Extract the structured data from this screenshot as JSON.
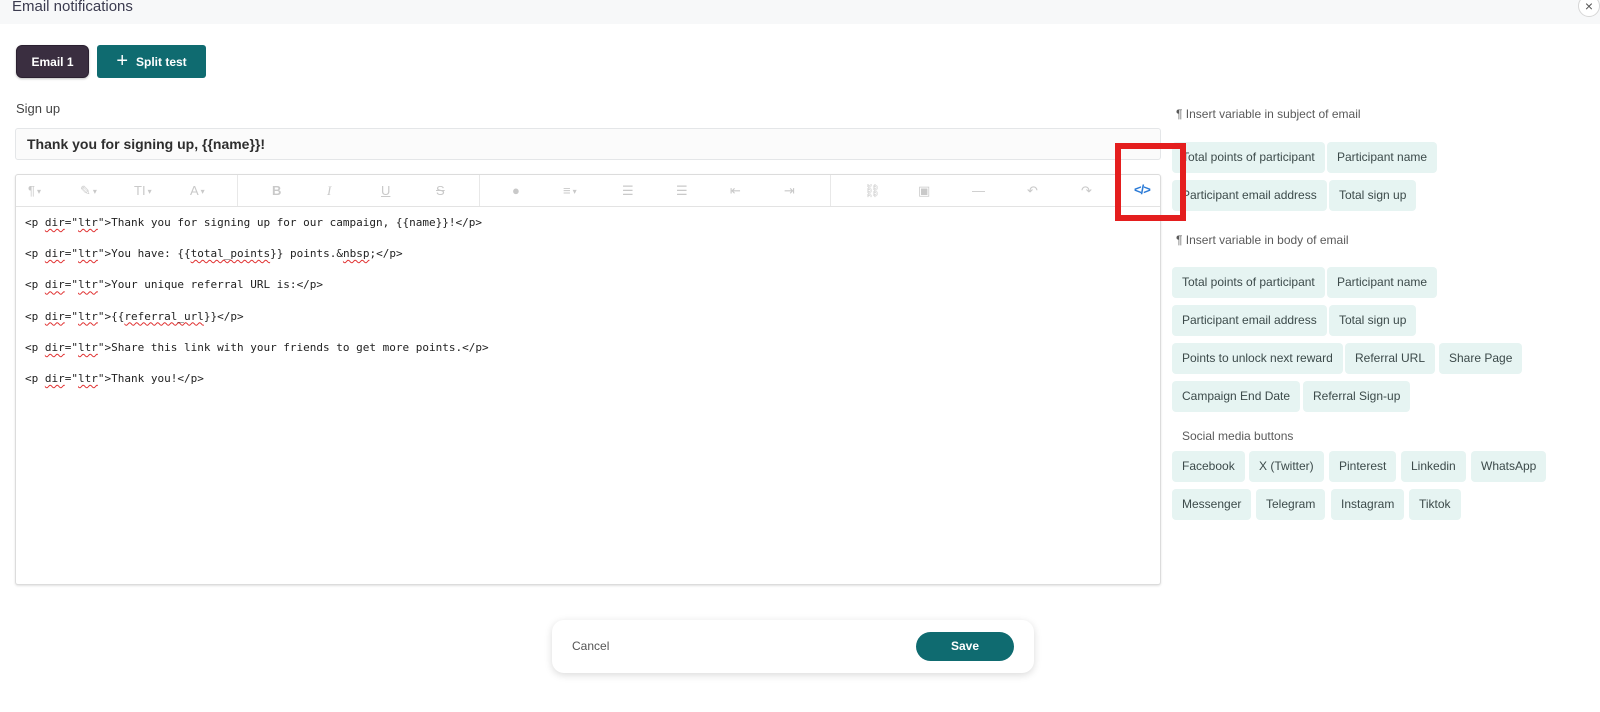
{
  "modal": {
    "title": "Email notifications",
    "close_glyph": "×"
  },
  "tabs": {
    "email_tab": "Email 1",
    "split_test": "Split test"
  },
  "section_label": "Sign up",
  "subject": {
    "value": "Thank you for signing up, {{name}}!"
  },
  "toolbar": {
    "paragraph": "¶",
    "text_size": "TI",
    "font_color": "A",
    "bold": "B",
    "italic": "I",
    "underline": "U",
    "strike": "S",
    "code_view": "</>"
  },
  "code_lines": {
    "l1": "Thank you for signing up for our campaign, {{name}}!",
    "l2_a": "You have: {{",
    "l2_var": "total_points",
    "l2_b": "}} points.&",
    "l2_nbsp": "nbsp",
    "l2_c": ";",
    "l3": "Your unique referral URL is:",
    "l4_a": "{{",
    "l4_var": "referral_url",
    "l4_b": "}}",
    "l5": "Share this link with your friends to get more points.",
    "l6": "Thank you!"
  },
  "subject_panel": {
    "heading": "¶ Insert variable in subject of email",
    "chips": [
      "Total points of participant",
      "Participant name",
      "Participant email address",
      "Total sign up"
    ]
  },
  "body_panel": {
    "heading": "¶ Insert variable in body of email",
    "chips": [
      "Total points of participant",
      "Participant name",
      "Participant email address",
      "Total sign up",
      "Points to unlock next reward",
      "Referral URL",
      "Share Page",
      "Campaign End Date",
      "Referral Sign-up"
    ]
  },
  "social": {
    "heading": "Social media buttons",
    "chips": [
      "Facebook",
      "X (Twitter)",
      "Pinterest",
      "Linkedin",
      "WhatsApp",
      "Messenger",
      "Telegram",
      "Instagram",
      "Tiktok"
    ]
  },
  "footer": {
    "cancel": "Cancel",
    "save": "Save"
  },
  "colors": {
    "primary": "#0f6b70",
    "tab_active": "#3a2e40",
    "chip_bg": "#e6f4f2",
    "highlight_box": "#e41e1e",
    "code_toggle": "#2a7ad6"
  }
}
